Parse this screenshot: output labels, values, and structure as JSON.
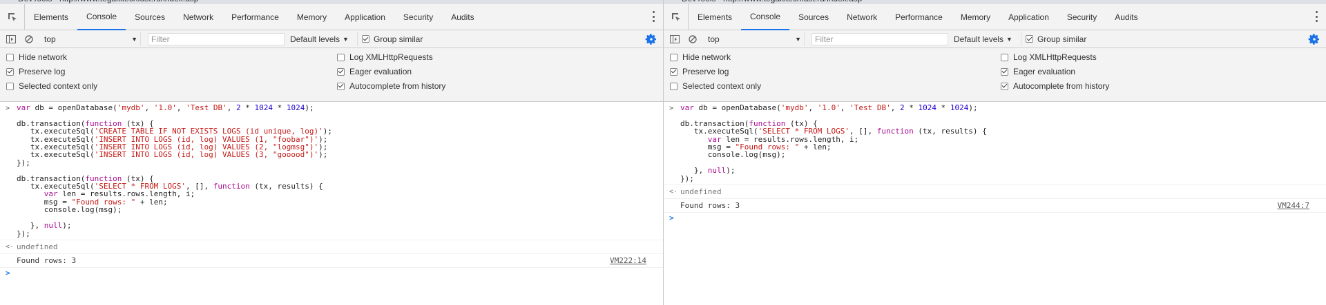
{
  "window_title": "DevTools - http://www.tegakitechfast.ru/index.asp",
  "tabs": [
    "Elements",
    "Console",
    "Sources",
    "Network",
    "Performance",
    "Memory",
    "Application",
    "Security",
    "Audits"
  ],
  "active_tab": "Console",
  "toolbar": {
    "context": "top",
    "filter_placeholder": "Filter",
    "levels_label": "Default levels",
    "group_similar_label": "Group similar",
    "group_similar_checked": true
  },
  "settings": {
    "hide_network": {
      "label": "Hide network",
      "checked": false
    },
    "preserve_log": {
      "label": "Preserve log",
      "checked": true
    },
    "selected_context": {
      "label": "Selected context only",
      "checked": false
    },
    "log_xhr": {
      "label": "Log XMLHttpRequests",
      "checked": false
    },
    "eager_eval": {
      "label": "Eager evaluation",
      "checked": true
    },
    "autocomplete": {
      "label": "Autocomplete from history",
      "checked": true
    }
  },
  "left_console": {
    "input_lines": [
      "var db = openDatabase('mydb', '1.0', 'Test DB', 2 * 1024 * 1024);",
      "",
      "db.transaction(function (tx) {",
      "   tx.executeSql('CREATE TABLE IF NOT EXISTS LOGS (id unique, log)');",
      "   tx.executeSql('INSERT INTO LOGS (id, log) VALUES (1, \"foobar\")');",
      "   tx.executeSql('INSERT INTO LOGS (id, log) VALUES (2, \"logmsg\")');",
      "   tx.executeSql('INSERT INTO LOGS (id, log) VALUES (3, \"gooood\")');",
      "});",
      "",
      "db.transaction(function (tx) {",
      "   tx.executeSql('SELECT * FROM LOGS', [], function (tx, results) {",
      "      var len = results.rows.length, i;",
      "      msg = \"Found rows: \" + len;",
      "      console.log(msg);",
      "",
      "   }, null);",
      "});"
    ],
    "result": "undefined",
    "log_message": "Found rows: 3",
    "log_source": "VM222:14"
  },
  "right_console": {
    "input_lines": [
      "var db = openDatabase('mydb', '1.0', 'Test DB', 2 * 1024 * 1024);",
      "",
      "db.transaction(function (tx) {",
      "   tx.executeSql('SELECT * FROM LOGS', [], function (tx, results) {",
      "      var len = results.rows.length, i;",
      "      msg = \"Found rows: \" + len;",
      "      console.log(msg);",
      "",
      "   }, null);",
      "});"
    ],
    "result": "undefined",
    "log_message": "Found rows: 3",
    "log_source": "VM244:7"
  },
  "colors": {
    "accent": "#1a73e8",
    "keyword": "#aa0d91",
    "string": "#c41a16",
    "number": "#1c00cf",
    "toolbar_bg": "#f3f3f3"
  }
}
